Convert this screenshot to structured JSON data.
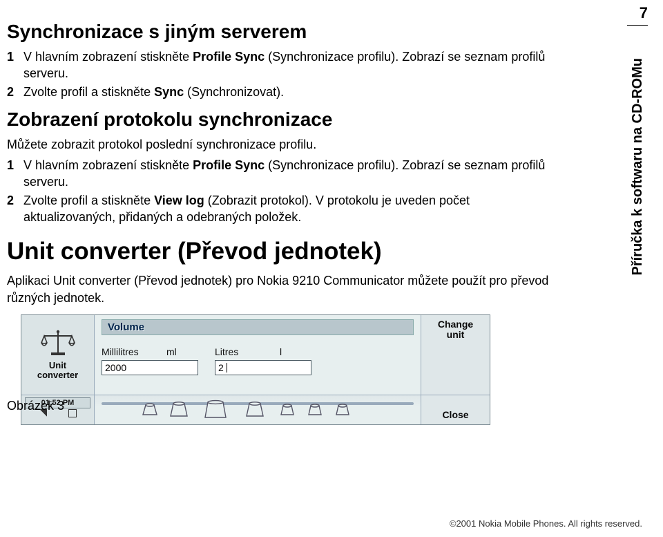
{
  "page_number": "7",
  "side_tab": "Příručka k softwaru na CD-ROMu",
  "h_sync_other": "Synchronizace s jiným serverem",
  "steps_a": {
    "n1": "1",
    "s1a": "V hlavním zobrazení stiskněte ",
    "s1b": "Profile Sync",
    "s1c": " (Synchronizace profilu). Zobrazí se seznam profilů serveru.",
    "n2": "2",
    "s2a": "Zvolte profil a stiskněte ",
    "s2b": "Sync",
    "s2c": " (Synchronizovat)."
  },
  "h_protocol": "Zobrazení protokolu synchronizace",
  "p_protocol": "Můžete zobrazit protokol poslední synchronizace profilu.",
  "steps_b": {
    "n1": "1",
    "s1a": "V hlavním zobrazení stiskněte ",
    "s1b": "Profile Sync",
    "s1c": " (Synchronizace profilu). Zobrazí se seznam profilů serveru.",
    "n2": "2",
    "s2a": "Zvolte profil a stiskněte ",
    "s2b": "View log",
    "s2c": " (Zobrazit protokol). V protokolu je uveden počet aktualizovaných, přidaných a odebraných položek."
  },
  "h_unit": "Unit converter (Převod jednotek)",
  "p_unit": "Aplikaci Unit converter (Převod jednotek) pro Nokia 9210 Communicator můžete použít pro převod různých jednotek.",
  "figure_label": "Obrázek 3",
  "shot": {
    "app_line1": "Unit",
    "app_line2": "converter",
    "title": "Volume",
    "from_unit": "Millilitres",
    "from_abbr": "ml",
    "from_value": "2000",
    "to_unit": "Litres",
    "to_abbr": "l",
    "to_value": "2",
    "softkey_top1": "Change",
    "softkey_top2": "unit",
    "softkey_bottom": "Close",
    "clock": "01:52 PM"
  },
  "footer": "©2001 Nokia Mobile Phones. All rights reserved."
}
